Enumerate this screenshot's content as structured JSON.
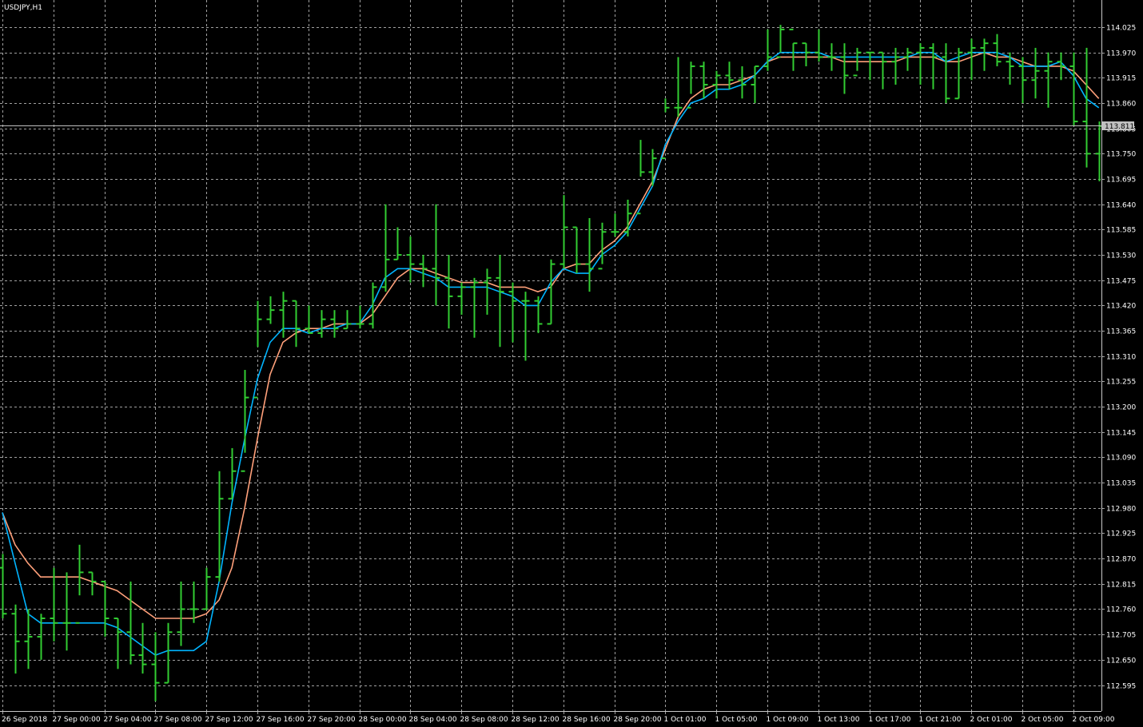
{
  "window": {
    "title": "USDJPY,H1"
  },
  "price_marker": {
    "label": "113.811",
    "value": 113.811
  },
  "colors": {
    "background": "#000000",
    "grid": "#a0a0a0",
    "bars": "#32cd32",
    "ma_fast": "#00b4ff",
    "ma_slow": "#ffa07a",
    "marker_bg": "#c0c0c0",
    "text": "#ffffff"
  },
  "chart_data": {
    "type": "ohlc",
    "symbol": "USDJPY",
    "timeframe": "H1",
    "grid": true,
    "ylim": [
      112.558,
      114.062
    ],
    "y_ticks": [
      "114.025",
      "113.970",
      "113.915",
      "113.860",
      "113.805",
      "113.750",
      "113.695",
      "113.640",
      "113.585",
      "113.530",
      "113.475",
      "113.420",
      "113.365",
      "113.310",
      "113.255",
      "113.200",
      "113.145",
      "113.090",
      "113.035",
      "112.980",
      "112.925",
      "112.870",
      "112.815",
      "112.760",
      "112.705",
      "112.650",
      "112.595"
    ],
    "x_ticks": [
      {
        "label": "26 Sep 2018",
        "bar": 0
      },
      {
        "label": "27 Sep 00:00",
        "bar": 4
      },
      {
        "label": "27 Sep 04:00",
        "bar": 8
      },
      {
        "label": "27 Sep 08:00",
        "bar": 12
      },
      {
        "label": "27 Sep 12:00",
        "bar": 16
      },
      {
        "label": "27 Sep 16:00",
        "bar": 20
      },
      {
        "label": "27 Sep 20:00",
        "bar": 24
      },
      {
        "label": "28 Sep 00:00",
        "bar": 28
      },
      {
        "label": "28 Sep 04:00",
        "bar": 32
      },
      {
        "label": "28 Sep 08:00",
        "bar": 36
      },
      {
        "label": "28 Sep 12:00",
        "bar": 40
      },
      {
        "label": "28 Sep 16:00",
        "bar": 44
      },
      {
        "label": "28 Sep 20:00",
        "bar": 48
      },
      {
        "label": "1 Oct 01:00",
        "bar": 52
      },
      {
        "label": "1 Oct 05:00",
        "bar": 56
      },
      {
        "label": "1 Oct 09:00",
        "bar": 60
      },
      {
        "label": "1 Oct 13:00",
        "bar": 64
      },
      {
        "label": "1 Oct 17:00",
        "bar": 68
      },
      {
        "label": "1 Oct 21:00",
        "bar": 72
      },
      {
        "label": "2 Oct 01:00",
        "bar": 76
      },
      {
        "label": "2 Oct 05:00",
        "bar": 80
      },
      {
        "label": "2 Oct 09:00",
        "bar": 84
      }
    ],
    "ohlc": [
      [
        112.85,
        112.88,
        112.74,
        112.75
      ],
      [
        112.75,
        112.77,
        112.62,
        112.69
      ],
      [
        112.69,
        112.76,
        112.63,
        112.7
      ],
      [
        112.7,
        112.75,
        112.65,
        112.74
      ],
      [
        112.74,
        112.85,
        112.69,
        112.73
      ],
      [
        112.73,
        112.84,
        112.67,
        112.73
      ],
      [
        112.73,
        112.9,
        112.79,
        112.84
      ],
      [
        112.84,
        112.84,
        112.79,
        112.82
      ],
      [
        112.82,
        112.82,
        112.7,
        112.74
      ],
      [
        112.74,
        112.74,
        112.63,
        112.71
      ],
      [
        112.71,
        112.82,
        112.64,
        112.66
      ],
      [
        112.66,
        112.73,
        112.62,
        112.64
      ],
      [
        112.64,
        112.71,
        112.56,
        112.6
      ],
      [
        112.6,
        112.73,
        112.6,
        112.71
      ],
      [
        112.71,
        112.82,
        112.68,
        112.76
      ],
      [
        112.76,
        112.82,
        112.73,
        112.76
      ],
      [
        112.76,
        112.85,
        112.76,
        112.83
      ],
      [
        112.83,
        113.06,
        112.82,
        113.0
      ],
      [
        113.0,
        113.11,
        113.0,
        113.06
      ],
      [
        113.06,
        113.28,
        113.1,
        113.22
      ],
      [
        113.22,
        113.43,
        113.33,
        113.39
      ],
      [
        113.39,
        113.44,
        113.38,
        113.41
      ],
      [
        113.41,
        113.45,
        113.35,
        113.43
      ],
      [
        113.43,
        113.43,
        113.33,
        113.37
      ],
      [
        113.37,
        113.42,
        113.36,
        113.36
      ],
      [
        113.36,
        113.41,
        113.35,
        113.39
      ],
      [
        113.39,
        113.41,
        113.35,
        113.37
      ],
      [
        113.37,
        113.41,
        113.37,
        113.38
      ],
      [
        113.38,
        113.42,
        113.37,
        113.38
      ],
      [
        113.38,
        113.47,
        113.37,
        113.46
      ],
      [
        113.46,
        113.64,
        113.45,
        113.52
      ],
      [
        113.52,
        113.59,
        113.52,
        113.53
      ],
      [
        113.53,
        113.57,
        113.47,
        113.51
      ],
      [
        113.51,
        113.53,
        113.46,
        113.5
      ],
      [
        113.5,
        113.64,
        113.42,
        113.48
      ],
      [
        113.48,
        113.53,
        113.37,
        113.44
      ],
      [
        113.44,
        113.47,
        113.4,
        113.46
      ],
      [
        113.46,
        113.48,
        113.35,
        113.47
      ],
      [
        113.47,
        113.5,
        113.4,
        113.48
      ],
      [
        113.48,
        113.53,
        113.33,
        113.45
      ],
      [
        113.45,
        113.47,
        113.34,
        113.43
      ],
      [
        113.43,
        113.45,
        113.3,
        113.43
      ],
      [
        113.43,
        113.44,
        113.36,
        113.38
      ],
      [
        113.38,
        113.52,
        113.38,
        113.51
      ],
      [
        113.51,
        113.66,
        113.5,
        113.59
      ],
      [
        113.59,
        113.59,
        113.49,
        113.51
      ],
      [
        113.51,
        113.61,
        113.45,
        113.5
      ],
      [
        113.5,
        113.6,
        113.51,
        113.58
      ],
      [
        113.58,
        113.62,
        113.57,
        113.58
      ],
      [
        113.58,
        113.65,
        113.57,
        113.62
      ],
      [
        113.62,
        113.78,
        113.7,
        113.71
      ],
      [
        113.71,
        113.76,
        113.68,
        113.74
      ],
      [
        113.74,
        113.87,
        113.84,
        113.85
      ],
      [
        113.85,
        113.96,
        113.83,
        113.85
      ],
      [
        113.85,
        113.95,
        113.88,
        113.94
      ],
      [
        113.94,
        113.95,
        113.87,
        113.9
      ],
      [
        113.9,
        113.93,
        113.87,
        113.92
      ],
      [
        113.92,
        113.95,
        113.89,
        113.91
      ],
      [
        113.91,
        113.94,
        113.87,
        113.9
      ],
      [
        113.9,
        113.94,
        113.86,
        113.94
      ],
      [
        113.94,
        114.02,
        113.93,
        113.96
      ],
      [
        113.96,
        114.03,
        113.97,
        114.02
      ],
      [
        114.02,
        113.99,
        113.93,
        113.99
      ],
      [
        113.99,
        113.99,
        113.94,
        113.97
      ],
      [
        113.97,
        114.02,
        113.95,
        113.96
      ],
      [
        113.96,
        113.99,
        113.93,
        113.96
      ],
      [
        113.96,
        113.99,
        113.88,
        113.92
      ],
      [
        113.92,
        113.98,
        113.93,
        113.97
      ],
      [
        113.97,
        113.97,
        113.91,
        113.97
      ],
      [
        113.97,
        113.97,
        113.89,
        113.95
      ],
      [
        113.95,
        113.98,
        113.9,
        113.96
      ],
      [
        113.96,
        113.98,
        113.93,
        113.97
      ],
      [
        113.97,
        113.99,
        113.9,
        113.98
      ],
      [
        113.98,
        113.99,
        113.89,
        113.96
      ],
      [
        113.96,
        113.99,
        113.86,
        113.87
      ],
      [
        113.87,
        113.98,
        113.87,
        113.97
      ],
      [
        113.97,
        114.0,
        113.91,
        113.98
      ],
      [
        113.98,
        114.0,
        113.93,
        113.99
      ],
      [
        113.99,
        114.01,
        113.94,
        113.95
      ],
      [
        113.95,
        113.97,
        113.9,
        113.94
      ],
      [
        113.94,
        113.96,
        113.86,
        113.91
      ],
      [
        113.91,
        113.98,
        113.87,
        113.93
      ],
      [
        113.93,
        113.97,
        113.85,
        113.95
      ],
      [
        113.95,
        113.97,
        113.91,
        113.94
      ],
      [
        113.94,
        113.97,
        113.81,
        113.82
      ],
      [
        113.82,
        113.98,
        113.72,
        113.75
      ],
      [
        113.75,
        113.82,
        113.69,
        113.81
      ]
    ],
    "series": [
      {
        "type": "line",
        "values": [
          112.97,
          112.9,
          112.86,
          112.83,
          112.83,
          112.83,
          112.83,
          112.82,
          112.81,
          112.8,
          112.78,
          112.76,
          112.74,
          112.74,
          112.74,
          112.74,
          112.75,
          112.78,
          112.85,
          112.98,
          113.13,
          113.27,
          113.34,
          113.36,
          113.37,
          113.37,
          113.38,
          113.38,
          113.38,
          113.4,
          113.44,
          113.48,
          113.5,
          113.5,
          113.49,
          113.48,
          113.47,
          113.47,
          113.47,
          113.46,
          113.46,
          113.46,
          113.45,
          113.46,
          113.5,
          113.51,
          113.51,
          113.54,
          113.56,
          113.59,
          113.64,
          113.69,
          113.76,
          113.83,
          113.87,
          113.89,
          113.9,
          113.9,
          113.91,
          113.92,
          113.95,
          113.96,
          113.96,
          113.96,
          113.96,
          113.96,
          113.95,
          113.95,
          113.95,
          113.95,
          113.95,
          113.96,
          113.96,
          113.96,
          113.95,
          113.95,
          113.96,
          113.97,
          113.96,
          113.96,
          113.95,
          113.94,
          113.94,
          113.94,
          113.93,
          113.9,
          113.87
        ]
      },
      {
        "type": "line",
        "values": [
          112.97,
          112.86,
          112.75,
          112.73,
          112.73,
          112.73,
          112.73,
          112.73,
          112.73,
          112.72,
          112.7,
          112.68,
          112.66,
          112.67,
          112.67,
          112.67,
          112.69,
          112.82,
          112.99,
          113.13,
          113.26,
          113.34,
          113.37,
          113.37,
          113.36,
          113.37,
          113.37,
          113.38,
          113.38,
          113.42,
          113.48,
          113.5,
          113.5,
          113.49,
          113.48,
          113.46,
          113.46,
          113.46,
          113.46,
          113.45,
          113.44,
          113.42,
          113.42,
          113.47,
          113.5,
          113.49,
          113.49,
          113.53,
          113.55,
          113.58,
          113.63,
          113.68,
          113.77,
          113.82,
          113.86,
          113.87,
          113.89,
          113.89,
          113.9,
          113.92,
          113.95,
          113.97,
          113.97,
          113.97,
          113.97,
          113.96,
          113.96,
          113.96,
          113.96,
          113.96,
          113.96,
          113.96,
          113.97,
          113.97,
          113.95,
          113.96,
          113.97,
          113.97,
          113.97,
          113.96,
          113.94,
          113.94,
          113.94,
          113.95,
          113.92,
          113.87,
          113.85
        ]
      }
    ]
  }
}
